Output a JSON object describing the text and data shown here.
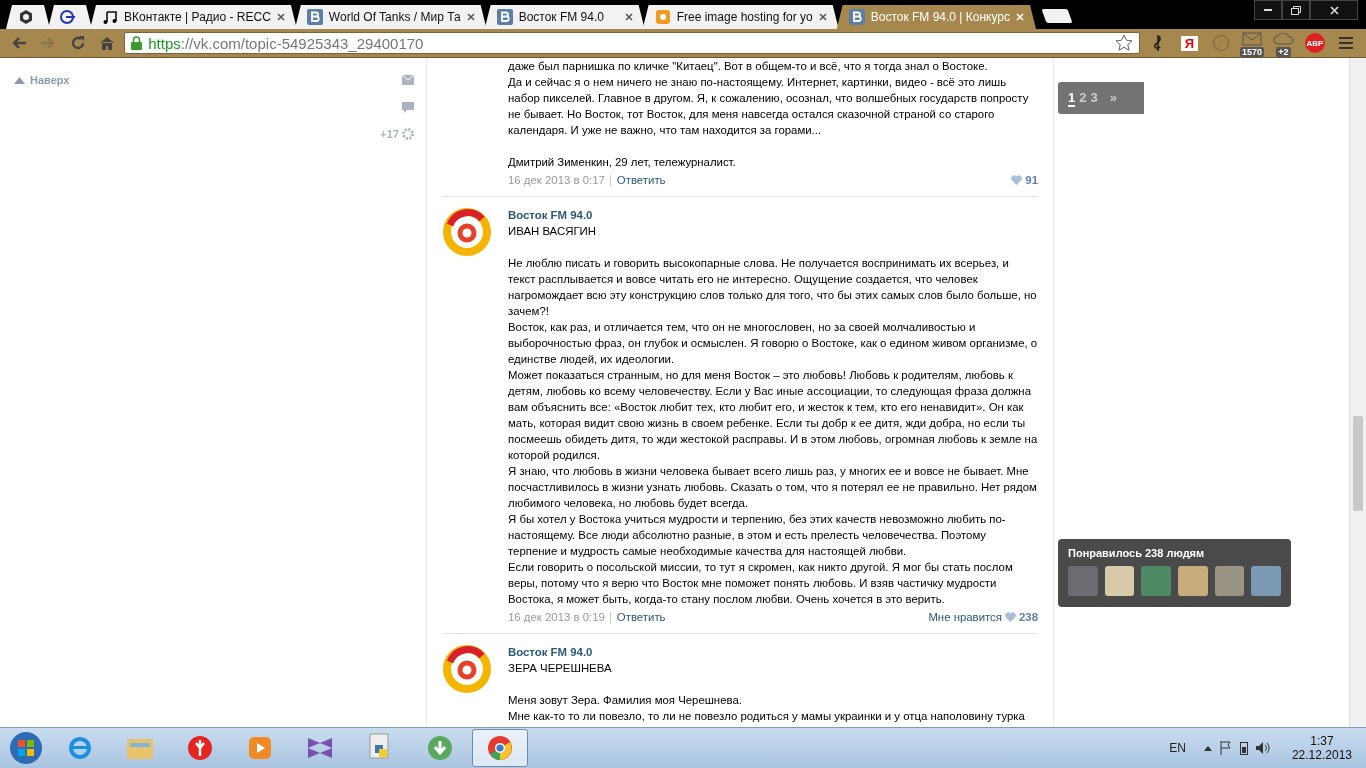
{
  "tabs": [
    {
      "kind": "pinned",
      "selected": false
    },
    {
      "kind": "pinned",
      "selected": false
    },
    {
      "kind": "music",
      "title": "ВКонтакте | Радио - RECC",
      "selected": false
    },
    {
      "kind": "vk",
      "title": "World Of Tanks / Мир Та",
      "selected": false
    },
    {
      "kind": "vk",
      "title": "Восток FM 94.0",
      "selected": false
    },
    {
      "kind": "image",
      "title": "Free image hosting for yo",
      "selected": false
    },
    {
      "kind": "vk",
      "title": "Восток FM 94.0 | Конкурс",
      "selected": true
    }
  ],
  "address": {
    "scheme": "https",
    "rest": "://vk.com/topic-54925343_29400170"
  },
  "extensions": [
    {
      "kind": "clef"
    },
    {
      "kind": "yandex",
      "label": "Я"
    },
    {
      "kind": "compass"
    },
    {
      "kind": "mail",
      "badge": "1570"
    },
    {
      "kind": "cloud",
      "badge": "+2"
    },
    {
      "kind": "abp",
      "label": "ABP"
    }
  ],
  "sidebar": {
    "up_link": "Наверх",
    "counter": "+17"
  },
  "pagination": {
    "pages": [
      {
        "label": "1",
        "selected": true
      },
      {
        "label": "2",
        "selected": false
      },
      {
        "label": "3",
        "selected": false
      }
    ],
    "next": "»"
  },
  "posts": [
    {
      "paragraphs": [
        "даже был парнишка по кличке \"Китаец\". Вот в общем-то и всё, что я тогда знал о Востоке.",
        "Да и сейчас я о нем ничего не знаю по-настоящему. Интернет, картинки, видео - всё это лишь набор пикселей.  Главное в другом. Я, к сожалению, осознал, что волшебных государств попросту не бывает. Но Восток, тот Восток, для меня навсегда остался сказочной страной со старого календаря. И уже не важно, что там находится за горами..."
      ],
      "signature": "Дмитрий Зименкин, 29 лет, тележурналист.",
      "date": "16 дек 2013 в 0:17",
      "reply": "Ответить",
      "likes": "91"
    },
    {
      "author": "Восток FM 94.0",
      "title": "ИВАН ВАСЯГИН",
      "paragraphs": [
        "Не люблю писать и говорить высокопарные слова. Не получается воспринимать их всерьез, и текст расплывается и вовсе читать его не интересно. Ощущение создается, что человек нагромождает всю эту конструкцию слов только для того, что бы этих самых слов было больше, но зачем?!",
        "Восток, как раз, и отличается тем, что он не многословен, но за своей молчаливостью и выборочностью фраз, он глубок и осмыслен. Я говорю о Востоке, как о едином живом организме, о единстве людей, их идеологии.",
        "Может показаться странным, но для меня Восток – это любовь! Любовь к родителям, любовь к детям, любовь ко всему человечеству. Если у Вас иные ассоциации, то следующая фраза должна вам объяснить все: «Восток любит тех, кто любит его, и жесток к тем, кто его ненавидит». Он как мать, которая видит свою жизнь в своем ребенке. Если ты добр к ее дитя, жди добра, но если ты посмеешь обидеть дитя, то жди жестокой расправы. И в этом любовь, огромная любовь к земле на которой родился.",
        "Я знаю, что любовь в жизни человека бывает всего лишь раз, у многих ее и вовсе не бывает. Мне посчастливилось в жизни узнать любовь. Сказать о том, что я потерял ее не правильно. Нет рядом любимого человека, но любовь будет всегда.",
        "Я бы хотел у Востока учиться мудрости и терпению, без этих качеств невозможно любить по-настоящему. Все люди абсолютно разные, в этом и есть прелесть человечества. Поэтому терпение и мудрость самые необходимые качества для настоящей любви.",
        "Если говорить о посольской миссии, то тут я скромен, как никто другой. Я мог бы стать послом веры, потому что я верю что Восток мне поможет понять любовь. И взяв частичку мудрости Востока, я может быть, когда-то стану послом любви. Очень хочется в это верить."
      ],
      "date": "16 дек 2013 в 0:19",
      "reply": "Ответить",
      "like_label": "Мне нравится",
      "likes": "238"
    },
    {
      "author": "Восток FM 94.0",
      "title": "ЗЕРА ЧЕРЕШНЕВА",
      "paragraphs": [
        "Меня зовут Зера. Фамилия моя Черешнева.",
        "Мне как-то то ли повезло, то ли не повезло родиться у мамы украинки и у отца наполовину турка"
      ]
    }
  ],
  "likes_tooltip": {
    "title": "Понравилось 238 людям"
  },
  "taskbar": {
    "apps": [
      {
        "kind": "ie",
        "selected": false
      },
      {
        "kind": "explorer",
        "selected": false
      },
      {
        "kind": "yandex",
        "selected": false
      },
      {
        "kind": "player",
        "selected": false
      },
      {
        "kind": "vs",
        "selected": false
      },
      {
        "kind": "python",
        "selected": false
      },
      {
        "kind": "download",
        "selected": false
      },
      {
        "kind": "chrome",
        "selected": true
      }
    ],
    "language": "EN",
    "time": "1:37",
    "date": "22.12.2013"
  }
}
